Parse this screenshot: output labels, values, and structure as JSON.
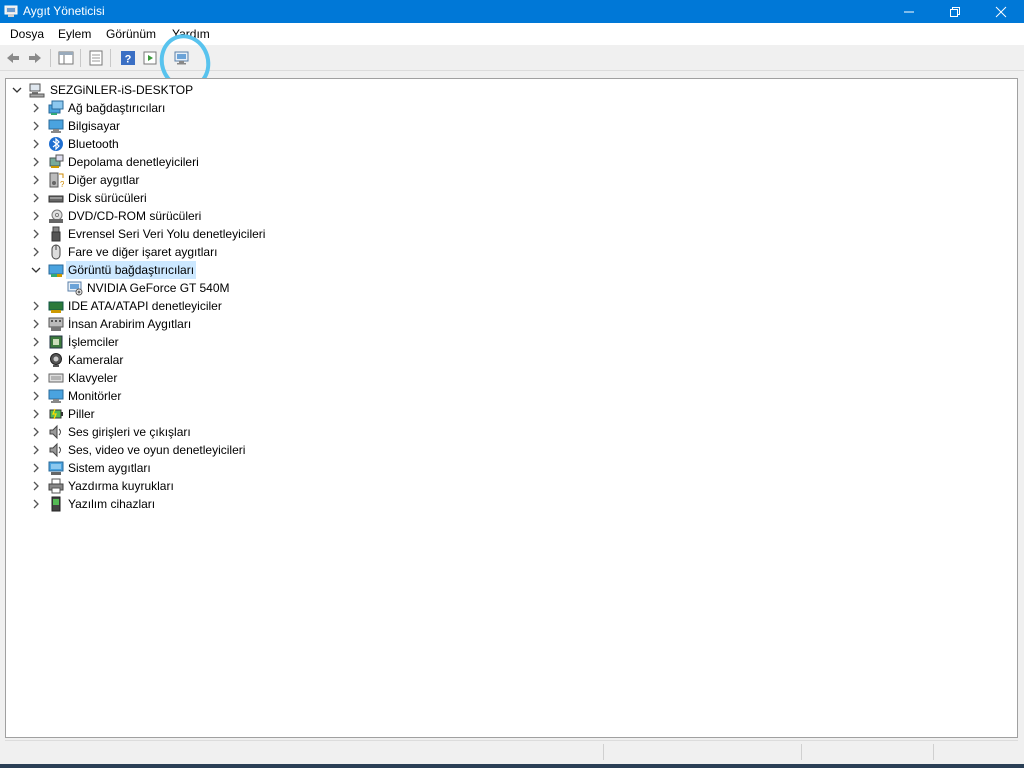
{
  "window": {
    "title": "Aygıt Yöneticisi",
    "title_color": "#0078d7"
  },
  "menu": [
    "Dosya",
    "Eylem",
    "Görünüm",
    "Yardım"
  ],
  "toolbar": {
    "icons": [
      "back-arrow-icon",
      "forward-arrow-icon",
      "show-hide-tree-icon",
      "properties-icon",
      "help-icon",
      "run-icon",
      "scan-hardware-icon"
    ],
    "annotation_color": "#58c3ee"
  },
  "tree": {
    "root": "SEZGiNLER-iS-DESKTOP",
    "categories": [
      {
        "label": "Ağ bağdaştırıcıları",
        "icon": "network-adapter-icon"
      },
      {
        "label": "Bilgisayar",
        "icon": "computer-icon"
      },
      {
        "label": "Bluetooth",
        "icon": "bluetooth-icon"
      },
      {
        "label": "Depolama denetleyicileri",
        "icon": "storage-controller-icon"
      },
      {
        "label": "Diğer aygıtlar",
        "icon": "other-devices-icon"
      },
      {
        "label": "Disk sürücüleri",
        "icon": "disk-drive-icon"
      },
      {
        "label": "DVD/CD-ROM sürücüleri",
        "icon": "dvd-drive-icon"
      },
      {
        "label": "Evrensel Seri Veri Yolu denetleyicileri",
        "icon": "usb-icon"
      },
      {
        "label": "Fare ve diğer işaret aygıtları",
        "icon": "mouse-icon"
      },
      {
        "label": "Görüntü bağdaştırıcıları",
        "icon": "display-adapter-icon",
        "expanded": true,
        "selected": true,
        "children": [
          {
            "label": "NVIDIA GeForce GT 540M",
            "icon": "gpu-icon"
          }
        ]
      },
      {
        "label": "IDE ATA/ATAPI denetleyiciler",
        "icon": "ide-controller-icon"
      },
      {
        "label": "İnsan Arabirim Aygıtları",
        "icon": "hid-icon"
      },
      {
        "label": "İşlemciler",
        "icon": "processor-icon"
      },
      {
        "label": "Kameralar",
        "icon": "camera-icon"
      },
      {
        "label": "Klavyeler",
        "icon": "keyboard-icon"
      },
      {
        "label": "Monitörler",
        "icon": "monitor-icon"
      },
      {
        "label": "Piller",
        "icon": "battery-icon"
      },
      {
        "label": "Ses girişleri ve çıkışları",
        "icon": "audio-io-icon"
      },
      {
        "label": "Ses, video ve oyun denetleyicileri",
        "icon": "sound-video-icon"
      },
      {
        "label": "Sistem aygıtları",
        "icon": "system-devices-icon"
      },
      {
        "label": "Yazdırma kuyrukları",
        "icon": "printer-icon"
      },
      {
        "label": "Yazılım cihazları",
        "icon": "software-device-icon"
      }
    ]
  }
}
